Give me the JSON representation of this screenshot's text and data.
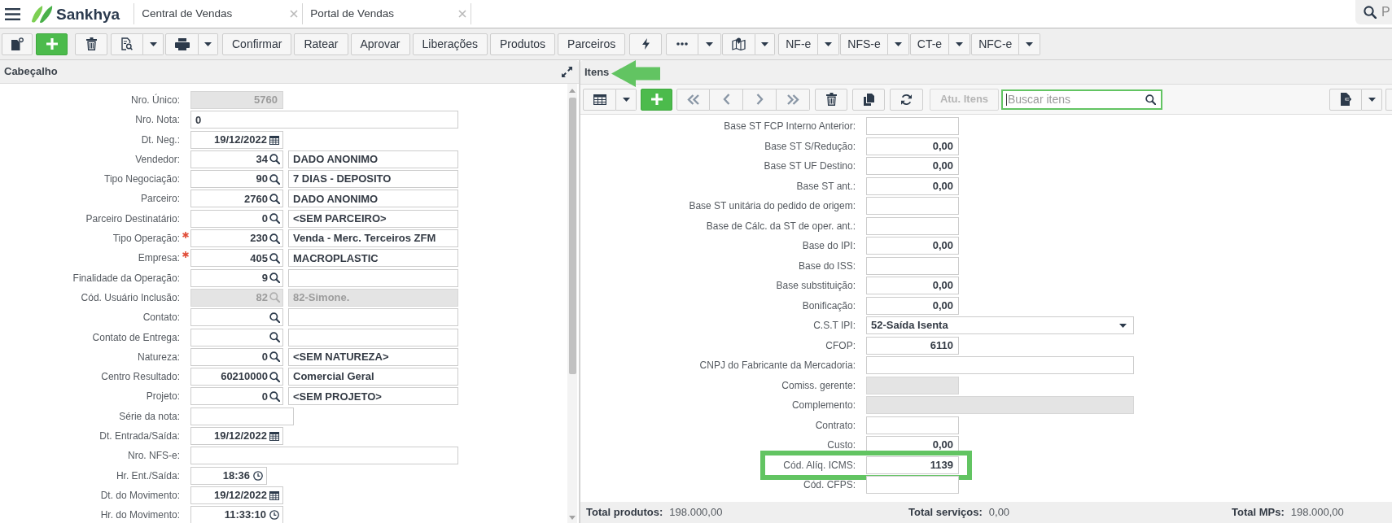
{
  "app": {
    "brand": "Sankhya",
    "tabs": [
      {
        "label": "Central de Vendas"
      },
      {
        "label": "Portal de Vendas"
      }
    ],
    "search": {
      "placeholder": "P"
    }
  },
  "toolbar": {
    "actions": [
      "Confirmar",
      "Ratear",
      "Aprovar",
      "Liberações",
      "Produtos",
      "Parceiros"
    ],
    "documents": [
      "NF-e",
      "NFS-e",
      "CT-e",
      "NFC-e"
    ]
  },
  "header_panel": {
    "title": "Cabeçalho",
    "fields": [
      {
        "label": "Nro. Único:",
        "kind": "number",
        "value": "5760",
        "required": false,
        "disabled": true
      },
      {
        "label": "Nro. Nota:",
        "kind": "text",
        "value": "0",
        "required": false,
        "disabled": false
      },
      {
        "label": "Dt. Neg.:",
        "kind": "date",
        "value": "19/12/2022",
        "required": false,
        "disabled": false
      },
      {
        "label": "Vendedor:",
        "kind": "lookup",
        "value": "34",
        "description": "DADO ANONIMO",
        "required": false,
        "disabled": false
      },
      {
        "label": "Tipo Negociação:",
        "kind": "lookup",
        "value": "90",
        "description": "7 DIAS - DEPOSITO",
        "required": false,
        "disabled": false
      },
      {
        "label": "Parceiro:",
        "kind": "lookup",
        "value": "2760",
        "description": "DADO ANONIMO",
        "required": false,
        "disabled": false
      },
      {
        "label": "Parceiro Destinatário:",
        "kind": "lookup",
        "value": "0",
        "description": "<SEM PARCEIRO>",
        "required": false,
        "disabled": false
      },
      {
        "label": "Tipo Operação:",
        "kind": "lookup",
        "value": "230",
        "description": "Venda - Merc. Terceiros ZFM",
        "required": true,
        "disabled": false
      },
      {
        "label": "Empresa:",
        "kind": "lookup",
        "value": "405",
        "description": "MACROPLASTIC",
        "required": true,
        "disabled": false
      },
      {
        "label": "Finalidade da Operação:",
        "kind": "lookup",
        "value": "9",
        "required": false,
        "disabled": false
      },
      {
        "label": "Cód. Usuário Inclusão:",
        "kind": "lookup",
        "value": "82",
        "description": "82-Simone.",
        "required": false,
        "disabled": true
      },
      {
        "label": "Contato:",
        "kind": "lookup",
        "required": false,
        "disabled": false
      },
      {
        "label": "Contato de Entrega:",
        "kind": "lookup",
        "required": false,
        "disabled": false
      },
      {
        "label": "Natureza:",
        "kind": "lookup",
        "value": "0",
        "description": "<SEM NATUREZA>",
        "required": false,
        "disabled": false
      },
      {
        "label": "Centro Resultado:",
        "kind": "lookup",
        "value": "60210000",
        "description": "Comercial Geral",
        "required": false,
        "disabled": false
      },
      {
        "label": "Projeto:",
        "kind": "lookup",
        "value": "0",
        "description": "<SEM PROJETO>",
        "required": false,
        "disabled": false
      },
      {
        "label": "Série da nota:",
        "kind": "short_text",
        "required": false,
        "disabled": false
      },
      {
        "label": "Dt. Entrada/Saída:",
        "kind": "date",
        "value": "19/12/2022",
        "required": false,
        "disabled": false
      },
      {
        "label": "Nro. NFS-e:",
        "kind": "text",
        "required": false,
        "disabled": false
      },
      {
        "label": "Hr. Ent./Saída:",
        "kind": "time",
        "value": "18:36",
        "required": false,
        "disabled": false
      },
      {
        "label": "Dt. do Movimento:",
        "kind": "date",
        "value": "19/12/2022",
        "required": false,
        "disabled": false
      },
      {
        "label": "Hr. do Movimento:",
        "kind": "time_long",
        "value": "11:33:10",
        "required": false,
        "disabled": false
      }
    ]
  },
  "items_panel": {
    "title": "Itens",
    "marked": true,
    "update_button": {
      "label": "Atu. Itens",
      "disabled": true
    },
    "search": {
      "placeholder": "Buscar itens",
      "focused": true
    },
    "fields": [
      {
        "label": "Base ST FCP Interno Anterior:",
        "kind": "number",
        "disabled": false,
        "highlighted": false
      },
      {
        "label": "Base ST S/Redução:",
        "kind": "number",
        "value": "0,00",
        "disabled": false,
        "highlighted": false
      },
      {
        "label": "Base ST UF Destino:",
        "kind": "number",
        "value": "0,00",
        "disabled": false,
        "highlighted": false
      },
      {
        "label": "Base ST ant.:",
        "kind": "number",
        "value": "0,00",
        "disabled": false,
        "highlighted": false
      },
      {
        "label": "Base ST unitária do pedido de origem:",
        "kind": "number",
        "disabled": false,
        "highlighted": false
      },
      {
        "label": "Base de Cálc. da ST de oper. ant.:",
        "kind": "number",
        "disabled": false,
        "highlighted": false
      },
      {
        "label": "Base do IPI:",
        "kind": "number",
        "value": "0,00",
        "disabled": false,
        "highlighted": false
      },
      {
        "label": "Base do ISS:",
        "kind": "number",
        "disabled": false,
        "highlighted": false
      },
      {
        "label": "Base substituição:",
        "kind": "number",
        "value": "0,00",
        "disabled": false,
        "highlighted": false
      },
      {
        "label": "Bonificação:",
        "kind": "number",
        "value": "0,00",
        "disabled": false,
        "highlighted": false
      },
      {
        "label": "C.S.T IPI:",
        "kind": "select",
        "value": "52-Saída Isenta",
        "disabled": false,
        "highlighted": false
      },
      {
        "label": "CFOP:",
        "kind": "number",
        "value": "6110",
        "disabled": false,
        "highlighted": false
      },
      {
        "label": "CNPJ do Fabricante da Mercadoria:",
        "kind": "text",
        "disabled": false,
        "highlighted": false
      },
      {
        "label": "Comiss. gerente:",
        "kind": "number",
        "disabled": true,
        "highlighted": false
      },
      {
        "label": "Complemento:",
        "kind": "text",
        "disabled": true,
        "highlighted": false
      },
      {
        "label": "Contrato:",
        "kind": "number",
        "disabled": false,
        "highlighted": false
      },
      {
        "label": "Custo:",
        "kind": "number",
        "value": "0,00",
        "disabled": false,
        "highlighted": false
      },
      {
        "label": "Cód. Alíq. ICMS:",
        "kind": "number",
        "value": "1139",
        "disabled": false,
        "highlighted": true
      },
      {
        "label": "Cód. CFPS:",
        "kind": "number",
        "disabled": false,
        "highlighted": false
      }
    ],
    "totals": [
      {
        "label": "Total produtos:",
        "value": "198.000,00"
      },
      {
        "label": "Total serviços:",
        "value": "0,00"
      },
      {
        "label": "Total MPs:",
        "value": "198.000,00"
      }
    ]
  }
}
